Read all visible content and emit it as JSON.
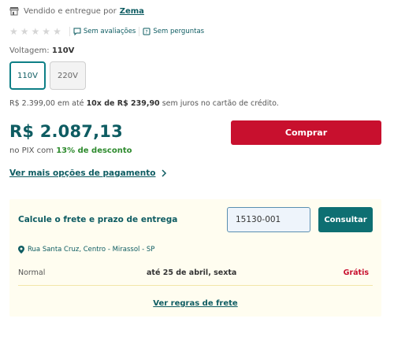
{
  "seller": {
    "prefix": "Vendido e entregue por",
    "name": "Zema",
    "icon": "store-icon"
  },
  "rating": {
    "stars": 0,
    "max_stars": 5,
    "reviews_label": "Sem avaliações",
    "questions_label": "Sem perguntas"
  },
  "voltage": {
    "label": "Voltagem:",
    "selected": "110V",
    "options": [
      "110V",
      "220V"
    ]
  },
  "installments": {
    "full_price": "R$ 2.399,00",
    "text1": "em até",
    "count": "10x de R$ 239,90",
    "text2": "sem juros no cartão de crédito."
  },
  "price": {
    "value": "R$ 2.087,13",
    "pix_prefix": "no PIX com",
    "pix_discount": "13% de desconto"
  },
  "buy_label": "Comprar",
  "more_payment_label": "Ver mais opções de pagamento",
  "shipping": {
    "title": "Calcule o frete e prazo de entrega",
    "cep_value": "15130-001",
    "consult_label": "Consultar",
    "address": "Rua Santa Cruz, Centro - Mirassol - SP",
    "rows": [
      {
        "type": "Normal",
        "eta": "até 25 de abril, sexta",
        "price": "Grátis"
      }
    ],
    "rules_label": "Ver regras de frete"
  },
  "colors": {
    "brand": "#0e5c62",
    "buy": "#c8102e",
    "pix": "#2e8b2e",
    "shipping_bg": "#fffdf0"
  }
}
